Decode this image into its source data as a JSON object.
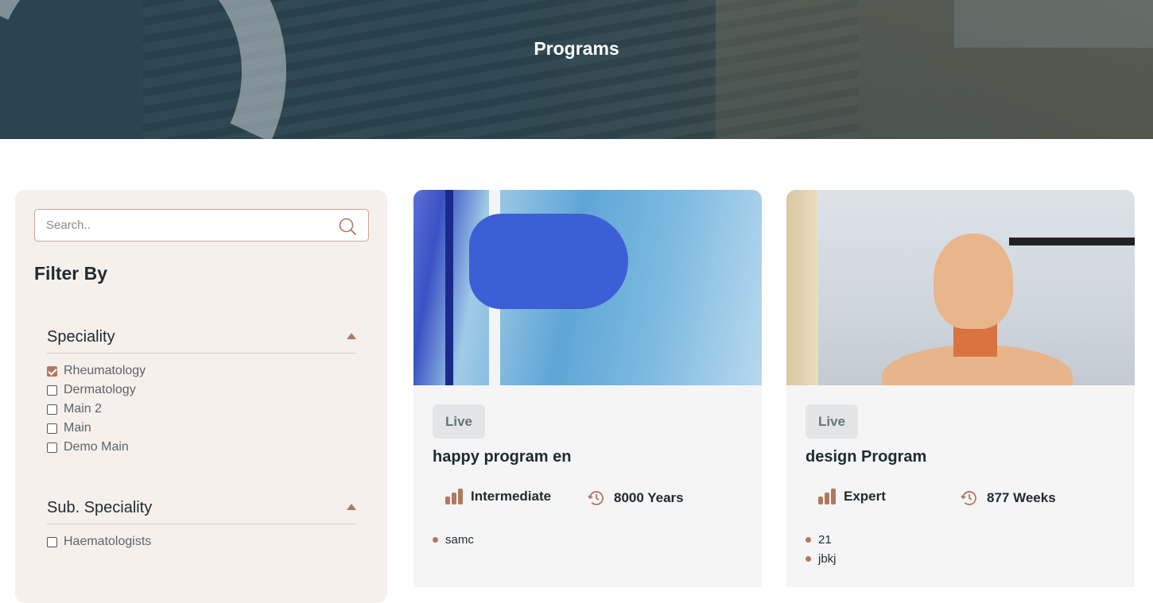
{
  "hero": {
    "title": "Programs"
  },
  "sidebar": {
    "search_placeholder": "Search..",
    "filter_title": "Filter By",
    "groups": [
      {
        "label": "Speciality",
        "options": [
          {
            "label": "Rheumatology",
            "checked": true
          },
          {
            "label": "Dermatology",
            "checked": false
          },
          {
            "label": "Main 2",
            "checked": false
          },
          {
            "label": "Main",
            "checked": false
          },
          {
            "label": "Demo Main",
            "checked": false
          }
        ]
      },
      {
        "label": "Sub. Speciality",
        "options": [
          {
            "label": "Haematologists",
            "checked": false
          }
        ]
      }
    ]
  },
  "programs": [
    {
      "badge": "Live",
      "title": "happy program en",
      "level": "Intermediate",
      "duration": "8000 Years",
      "tags": [
        "samc"
      ]
    },
    {
      "badge": "Live",
      "title": "design Program",
      "level": "Expert",
      "duration": "877 Weeks",
      "tags": [
        "21",
        "jbkj"
      ]
    }
  ],
  "colors": {
    "accent": "#b07860",
    "sidebar_bg": "#f6f0ed",
    "card_bg": "#f5f5f5"
  }
}
